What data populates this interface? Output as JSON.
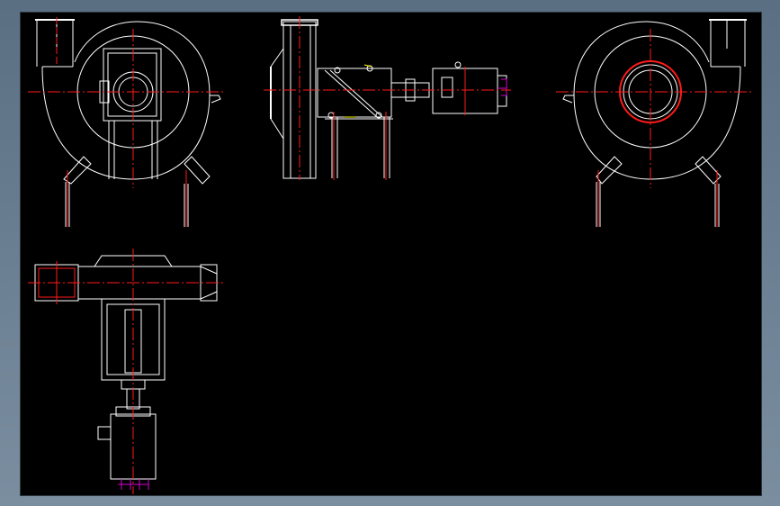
{
  "app": {
    "title": ""
  },
  "viewport": {
    "background": "#000000"
  },
  "colors": {
    "outline": "#ffffff",
    "centerline": "#ff1a1a",
    "accent": "#ffff00",
    "dimension": "#d000d0",
    "frame_bg": "#6a7f92"
  },
  "views": [
    {
      "name": "front-view"
    },
    {
      "name": "side-view"
    },
    {
      "name": "rear-view"
    },
    {
      "name": "top-view"
    }
  ]
}
